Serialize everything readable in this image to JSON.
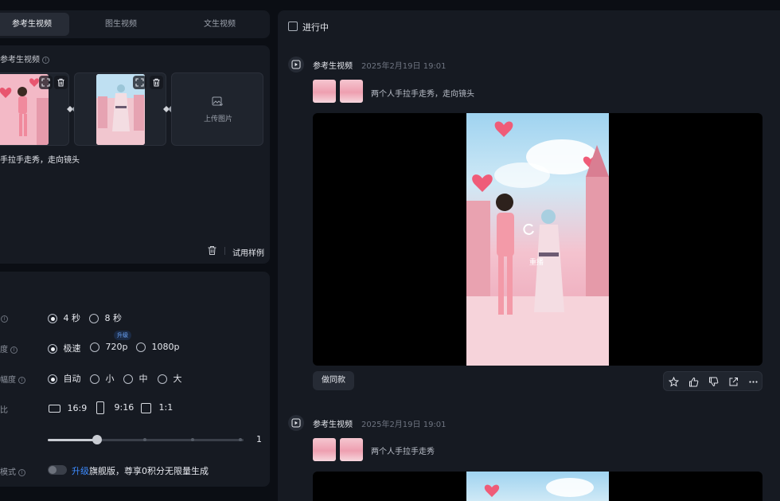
{
  "tabs": [
    {
      "label": "参考生视频",
      "active": true
    },
    {
      "label": "图生视频",
      "active": false
    },
    {
      "label": "文生视频",
      "active": false
    }
  ],
  "reference": {
    "label": "参考生视频",
    "upload_label": "上传图片",
    "prompt": "两个人手拉手走秀，走向镜头",
    "prompt_visible": "手拉手走秀，走向镜头",
    "sample_label": "试用样例"
  },
  "settings": {
    "duration": {
      "options": [
        "4 秒",
        "8 秒"
      ],
      "selected": 0
    },
    "speed": {
      "label_fragment": "度",
      "options": [
        "极速",
        "720p",
        "1080p"
      ],
      "selected": 0,
      "badge": "升级"
    },
    "motion": {
      "label_fragment": "幅度",
      "options": [
        "自动",
        "小",
        "中",
        "大"
      ],
      "selected": 0
    },
    "ratio": {
      "label_fragment": "比",
      "options": [
        "16:9",
        "9:16",
        "1:1"
      ],
      "selected": 1
    },
    "count": {
      "value": "1",
      "fraction": 0.25
    },
    "mode": {
      "label_fragment": "模式",
      "link_text": "升级",
      "text": "旗舰版，尊享0积分无限量生成"
    }
  },
  "right": {
    "in_progress_label": "进行中",
    "items": [
      {
        "title": "参考生视频",
        "time": "2025年2月19日 19:01",
        "prompt": "两个人手拉手走秀，走向镜头",
        "overlay_label": "重播",
        "action_label": "做同款"
      },
      {
        "title": "参考生视频",
        "time": "2025年2月19日 19:01",
        "prompt": "两个人手拉手走秀"
      }
    ]
  },
  "icons": {
    "info": "info-icon",
    "crop": "crop-icon",
    "trash": "trash-icon",
    "link": "link-icon",
    "upload": "image-upload-icon",
    "video": "video-icon",
    "replay": "replay-icon",
    "star": "star-icon",
    "like": "thumbs-up-icon",
    "dislike": "thumbs-down-icon",
    "share": "share-icon",
    "more": "more-icon"
  },
  "colors": {
    "background": "#0b0e14",
    "panel": "#161a22",
    "accent_link": "#3d8bff"
  }
}
